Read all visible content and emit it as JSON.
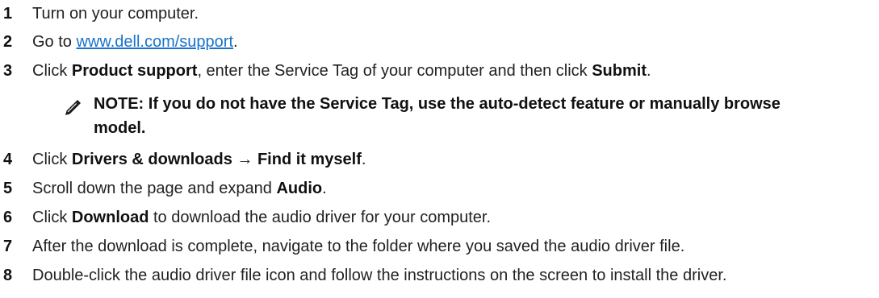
{
  "steps": [
    {
      "num": "1",
      "text": "Turn on your computer."
    },
    {
      "num": "2",
      "pre": "Go to ",
      "link": "www.dell.com/support",
      "post": "."
    },
    {
      "num": "3",
      "pre": "Click ",
      "bold1": "Product support",
      "mid": ", enter the Service Tag of your computer and then click ",
      "bold2": "Submit",
      "post": "."
    },
    {
      "num": "4",
      "pre": "Click ",
      "bold1": "Drivers & downloads",
      "arrow": " → ",
      "bold2": "Find it myself",
      "post": "."
    },
    {
      "num": "5",
      "pre": "Scroll down the page and expand ",
      "bold1": "Audio",
      "post": "."
    },
    {
      "num": "6",
      "pre": "Click ",
      "bold1": "Download",
      "post": " to download the audio driver for your computer."
    },
    {
      "num": "7",
      "text": "After the download is complete, navigate to the folder where you saved the audio driver file."
    },
    {
      "num": "8",
      "text": "Double-click the audio driver file icon and follow the instructions on the screen to install the driver."
    }
  ],
  "note": {
    "line1": "NOTE: If you do not have the Service Tag, use the auto-detect feature or manually browse",
    "line2": "model.",
    "icon": "pencil-icon"
  }
}
